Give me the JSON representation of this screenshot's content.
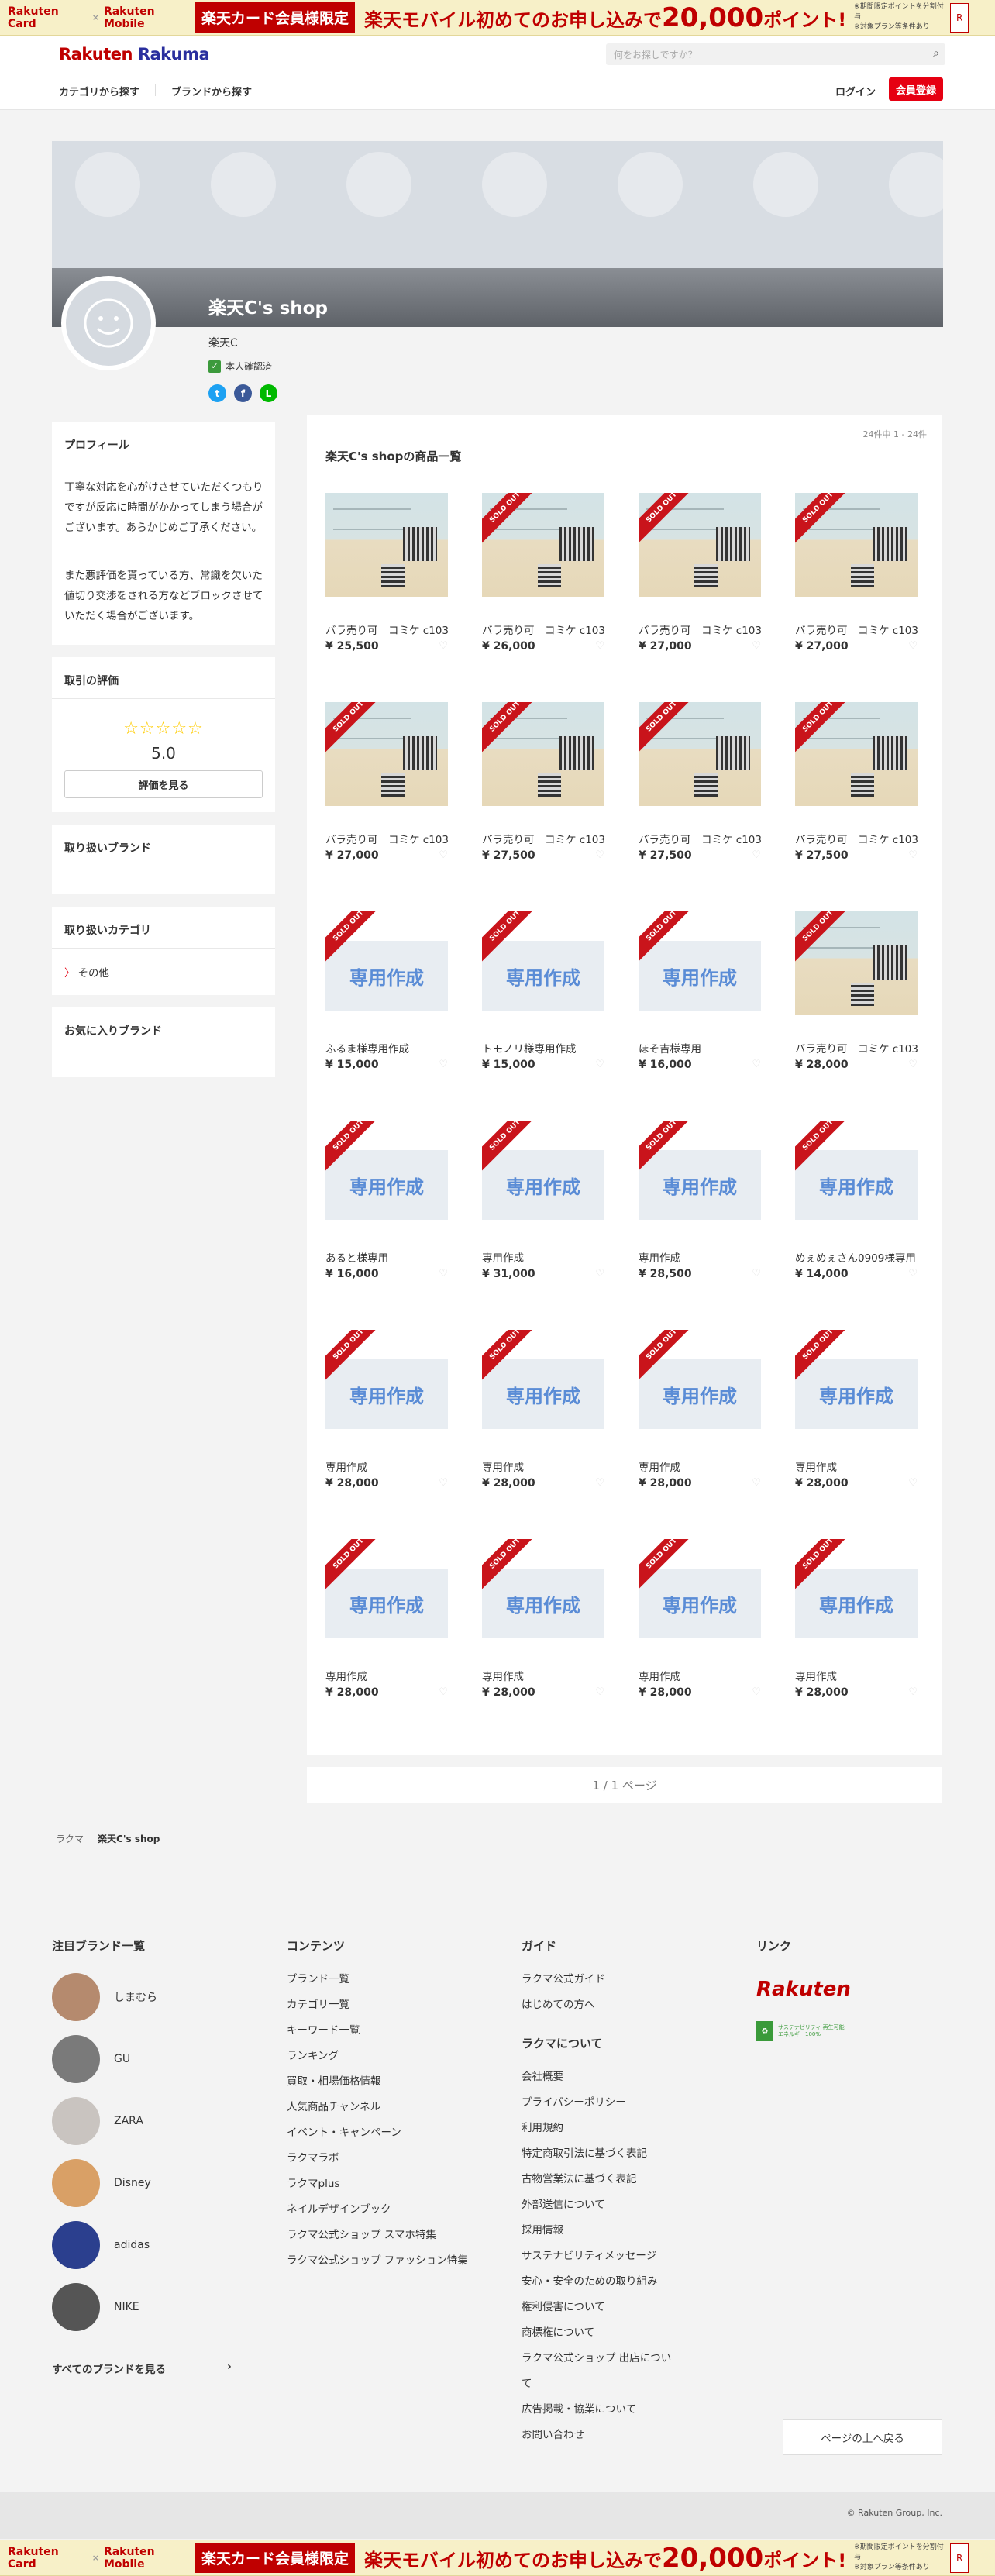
{
  "banner": {
    "rakuten_card": "Rakuten Card",
    "times": "×",
    "rakuten_mobile": "Rakuten Mobile",
    "tag": "楽天カード会員様限定",
    "message_pre": "楽天モバイル初めてのお申し込みで",
    "message_big": "20,000",
    "message_post": "ポイント!",
    "note_1": "※期間限定ポイントを分割付与",
    "note_2": "※対象プラン等条件あり",
    "cta": "R"
  },
  "header": {
    "logo_rakuten": "Rakuten",
    "logo_rakuma": "Rakuma",
    "search_placeholder": "何をお探しですか？",
    "nav_category": "カテゴリから探す",
    "nav_brand": "ブランドから探す",
    "login": "ログイン",
    "signup": "会員登録"
  },
  "shop": {
    "name": "楽天C's shop",
    "user": "楽天C",
    "verified": "本人確認済",
    "verified_icon": "✓",
    "social": [
      "t",
      "f",
      "L"
    ]
  },
  "sidebar": {
    "profile_title": "プロフィール",
    "profile_p1": "丁寧な対応を心がけさせていただくつもりですが反応に時間がかかってしまう場合がございます。あらかじめご了承ください。",
    "profile_p2": "また悪評価を貰っている方、常識を欠いた値切り交渉をされる方などブロックさせていただく場合がございます。",
    "rating_title": "取引の評価",
    "stars": "☆☆☆☆☆",
    "rating_value": "5.0",
    "rating_button": "評価を見る",
    "brands_title": "取り扱いブランド",
    "categories_title": "取り扱いカテゴリ",
    "category_marker": "〉",
    "category_item": "その他",
    "fav_brands_title": "お気に入りブランド"
  },
  "main": {
    "count": "24件中 1 - 24件",
    "title": "楽天C's shopの商品一覧",
    "sold_out": "SOLD OUT",
    "custom_label": "専用作成",
    "heart": "♡",
    "items": [
      {
        "name": "バラ売り可　コミケ c103",
        "price": "¥ 25,500",
        "type": "ticket",
        "sold": false
      },
      {
        "name": "バラ売り可　コミケ c103",
        "price": "¥ 26,000",
        "type": "ticket",
        "sold": true
      },
      {
        "name": "バラ売り可　コミケ c103",
        "price": "¥ 27,000",
        "type": "ticket",
        "sold": true
      },
      {
        "name": "バラ売り可　コミケ c103",
        "price": "¥ 27,000",
        "type": "ticket",
        "sold": true
      },
      {
        "name": "バラ売り可　コミケ c103",
        "price": "¥ 27,000",
        "type": "ticket",
        "sold": true
      },
      {
        "name": "バラ売り可　コミケ c103",
        "price": "¥ 27,500",
        "type": "ticket",
        "sold": true
      },
      {
        "name": "バラ売り可　コミケ c103",
        "price": "¥ 27,500",
        "type": "ticket",
        "sold": true
      },
      {
        "name": "バラ売り可　コミケ c103",
        "price": "¥ 27,500",
        "type": "ticket",
        "sold": true
      },
      {
        "name": "ふるま様専用作成",
        "price": "¥ 15,000",
        "type": "custom",
        "sold": true
      },
      {
        "name": "トモノリ様専用作成",
        "price": "¥ 15,000",
        "type": "custom",
        "sold": true
      },
      {
        "name": "ほそ吉様専用",
        "price": "¥ 16,000",
        "type": "custom",
        "sold": true
      },
      {
        "name": "バラ売り可　コミケ c103",
        "price": "¥ 28,000",
        "type": "ticket",
        "sold": true
      },
      {
        "name": "あると様専用",
        "price": "¥ 16,000",
        "type": "custom",
        "sold": true
      },
      {
        "name": "専用作成",
        "price": "¥ 31,000",
        "type": "custom",
        "sold": true
      },
      {
        "name": "専用作成",
        "price": "¥ 28,500",
        "type": "custom",
        "sold": true
      },
      {
        "name": "めぇめぇさん0909様専用",
        "price": "¥ 14,000",
        "type": "custom",
        "sold": true
      },
      {
        "name": "専用作成",
        "price": "¥ 28,000",
        "type": "custom",
        "sold": true
      },
      {
        "name": "専用作成",
        "price": "¥ 28,000",
        "type": "custom",
        "sold": true
      },
      {
        "name": "専用作成",
        "price": "¥ 28,000",
        "type": "custom",
        "sold": true
      },
      {
        "name": "専用作成",
        "price": "¥ 28,000",
        "type": "custom",
        "sold": true
      },
      {
        "name": "専用作成",
        "price": "¥ 28,000",
        "type": "custom",
        "sold": true
      },
      {
        "name": "専用作成",
        "price": "¥ 28,000",
        "type": "custom",
        "sold": true
      },
      {
        "name": "専用作成",
        "price": "¥ 28,000",
        "type": "custom",
        "sold": true
      },
      {
        "name": "専用作成",
        "price": "¥ 28,000",
        "type": "custom",
        "sold": true
      }
    ],
    "pager": "1 / 1 ページ"
  },
  "breadcrumb": {
    "root": "ラクマ",
    "current": "楽天C's shop"
  },
  "footer": {
    "brands_title": "注目ブランド一覧",
    "brands": [
      {
        "name": "しまむら",
        "color": "#b58a6e"
      },
      {
        "name": "GU",
        "color": "#7a7a7a"
      },
      {
        "name": "ZARA",
        "color": "#c9c4c0"
      },
      {
        "name": "Disney",
        "color": "#d9a066"
      },
      {
        "name": "adidas",
        "color": "#2b3f8e"
      },
      {
        "name": "NIKE",
        "color": "#555555"
      }
    ],
    "all_brands": "すべてのブランドを見る",
    "all_brands_arrow": "›",
    "contents_title": "コンテンツ",
    "contents": [
      "ブランド一覧",
      "カテゴリ一覧",
      "キーワード一覧",
      "ランキング",
      "買取・相場価格情報",
      "人気商品チャンネル",
      "イベント・キャンペーン",
      "ラクマラボ",
      "ラクマplus",
      "ネイルデザインブック",
      "ラクマ公式ショップ スマホ特集",
      "ラクマ公式ショップ ファッション特集"
    ],
    "guide_title": "ガイド",
    "guide": [
      "ラクマ公式ガイド",
      "はじめての方へ"
    ],
    "about_title": "ラクマについて",
    "about": [
      "会社概要",
      "プライバシーポリシー",
      "利用規約",
      "特定商取引法に基づく表記",
      "古物営業法に基づく表記",
      "外部送信について",
      "採用情報",
      "サステナビリティメッセージ",
      "安心・安全のための取り組み",
      "権利侵害について",
      "商標権について",
      "ラクマ公式ショップ 出店について",
      "広告掲載・協業について",
      "お問い合わせ"
    ],
    "links_title": "リンク",
    "rakuten_logo": "Rakuten",
    "sdgs_box": "♻",
    "sdgs_text": "サステナビリティ 再生可能エネルギー100%",
    "to_top": "ページの上へ戻る",
    "copyright": "© Rakuten Group, Inc."
  }
}
